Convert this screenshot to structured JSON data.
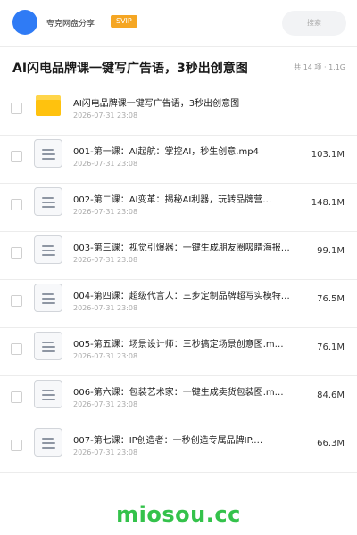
{
  "header": {
    "share_title": "夸克网盘分享",
    "badge": "SVIP",
    "search_placeholder": "搜索",
    "avatar_color": "#2f7bf5"
  },
  "folder": {
    "title": "AI闪电品牌课一键写广告语，3秒出创意图",
    "meta": "共 14 项 · 1.1G"
  },
  "items": [
    {
      "type": "folder",
      "name": "AI闪电品牌课一键写广告语，3秒出创意图",
      "date": "2026-07-31 23:08",
      "size": ""
    },
    {
      "type": "file",
      "name": "001-第一课：AI起航：掌控AI，秒生创意.mp4",
      "date": "2026-07-31 23:08",
      "size": "103.1M"
    },
    {
      "type": "file",
      "name": "002-第二课：AI变革：揭秘AI利器，玩转品牌营…",
      "date": "2026-07-31 23:08",
      "size": "148.1M"
    },
    {
      "type": "file",
      "name": "003-第三课：视觉引爆器：一键生成朋友圈吸睛海报…",
      "date": "2026-07-31 23:08",
      "size": "99.1M"
    },
    {
      "type": "file",
      "name": "004-第四课：超级代言人：三步定制品牌超写实模特…",
      "date": "2026-07-31 23:08",
      "size": "76.5M"
    },
    {
      "type": "file",
      "name": "005-第五课：场景设计师：三秒搞定场景创意图.m…",
      "date": "2026-07-31 23:08",
      "size": "76.1M"
    },
    {
      "type": "file",
      "name": "006-第六课：包装艺术家：一键生成卖货包装图.m…",
      "date": "2026-07-31 23:08",
      "size": "84.6M"
    },
    {
      "type": "file",
      "name": "007-第七课：IP创造者：一秒创造专属品牌IP.…",
      "date": "2026-07-31 23:08",
      "size": "66.3M"
    }
  ],
  "watermark": "miosou.cc",
  "colors": {
    "badge": "#f5a623",
    "folder": "#ffc20e",
    "watermark": "#34c24b"
  }
}
